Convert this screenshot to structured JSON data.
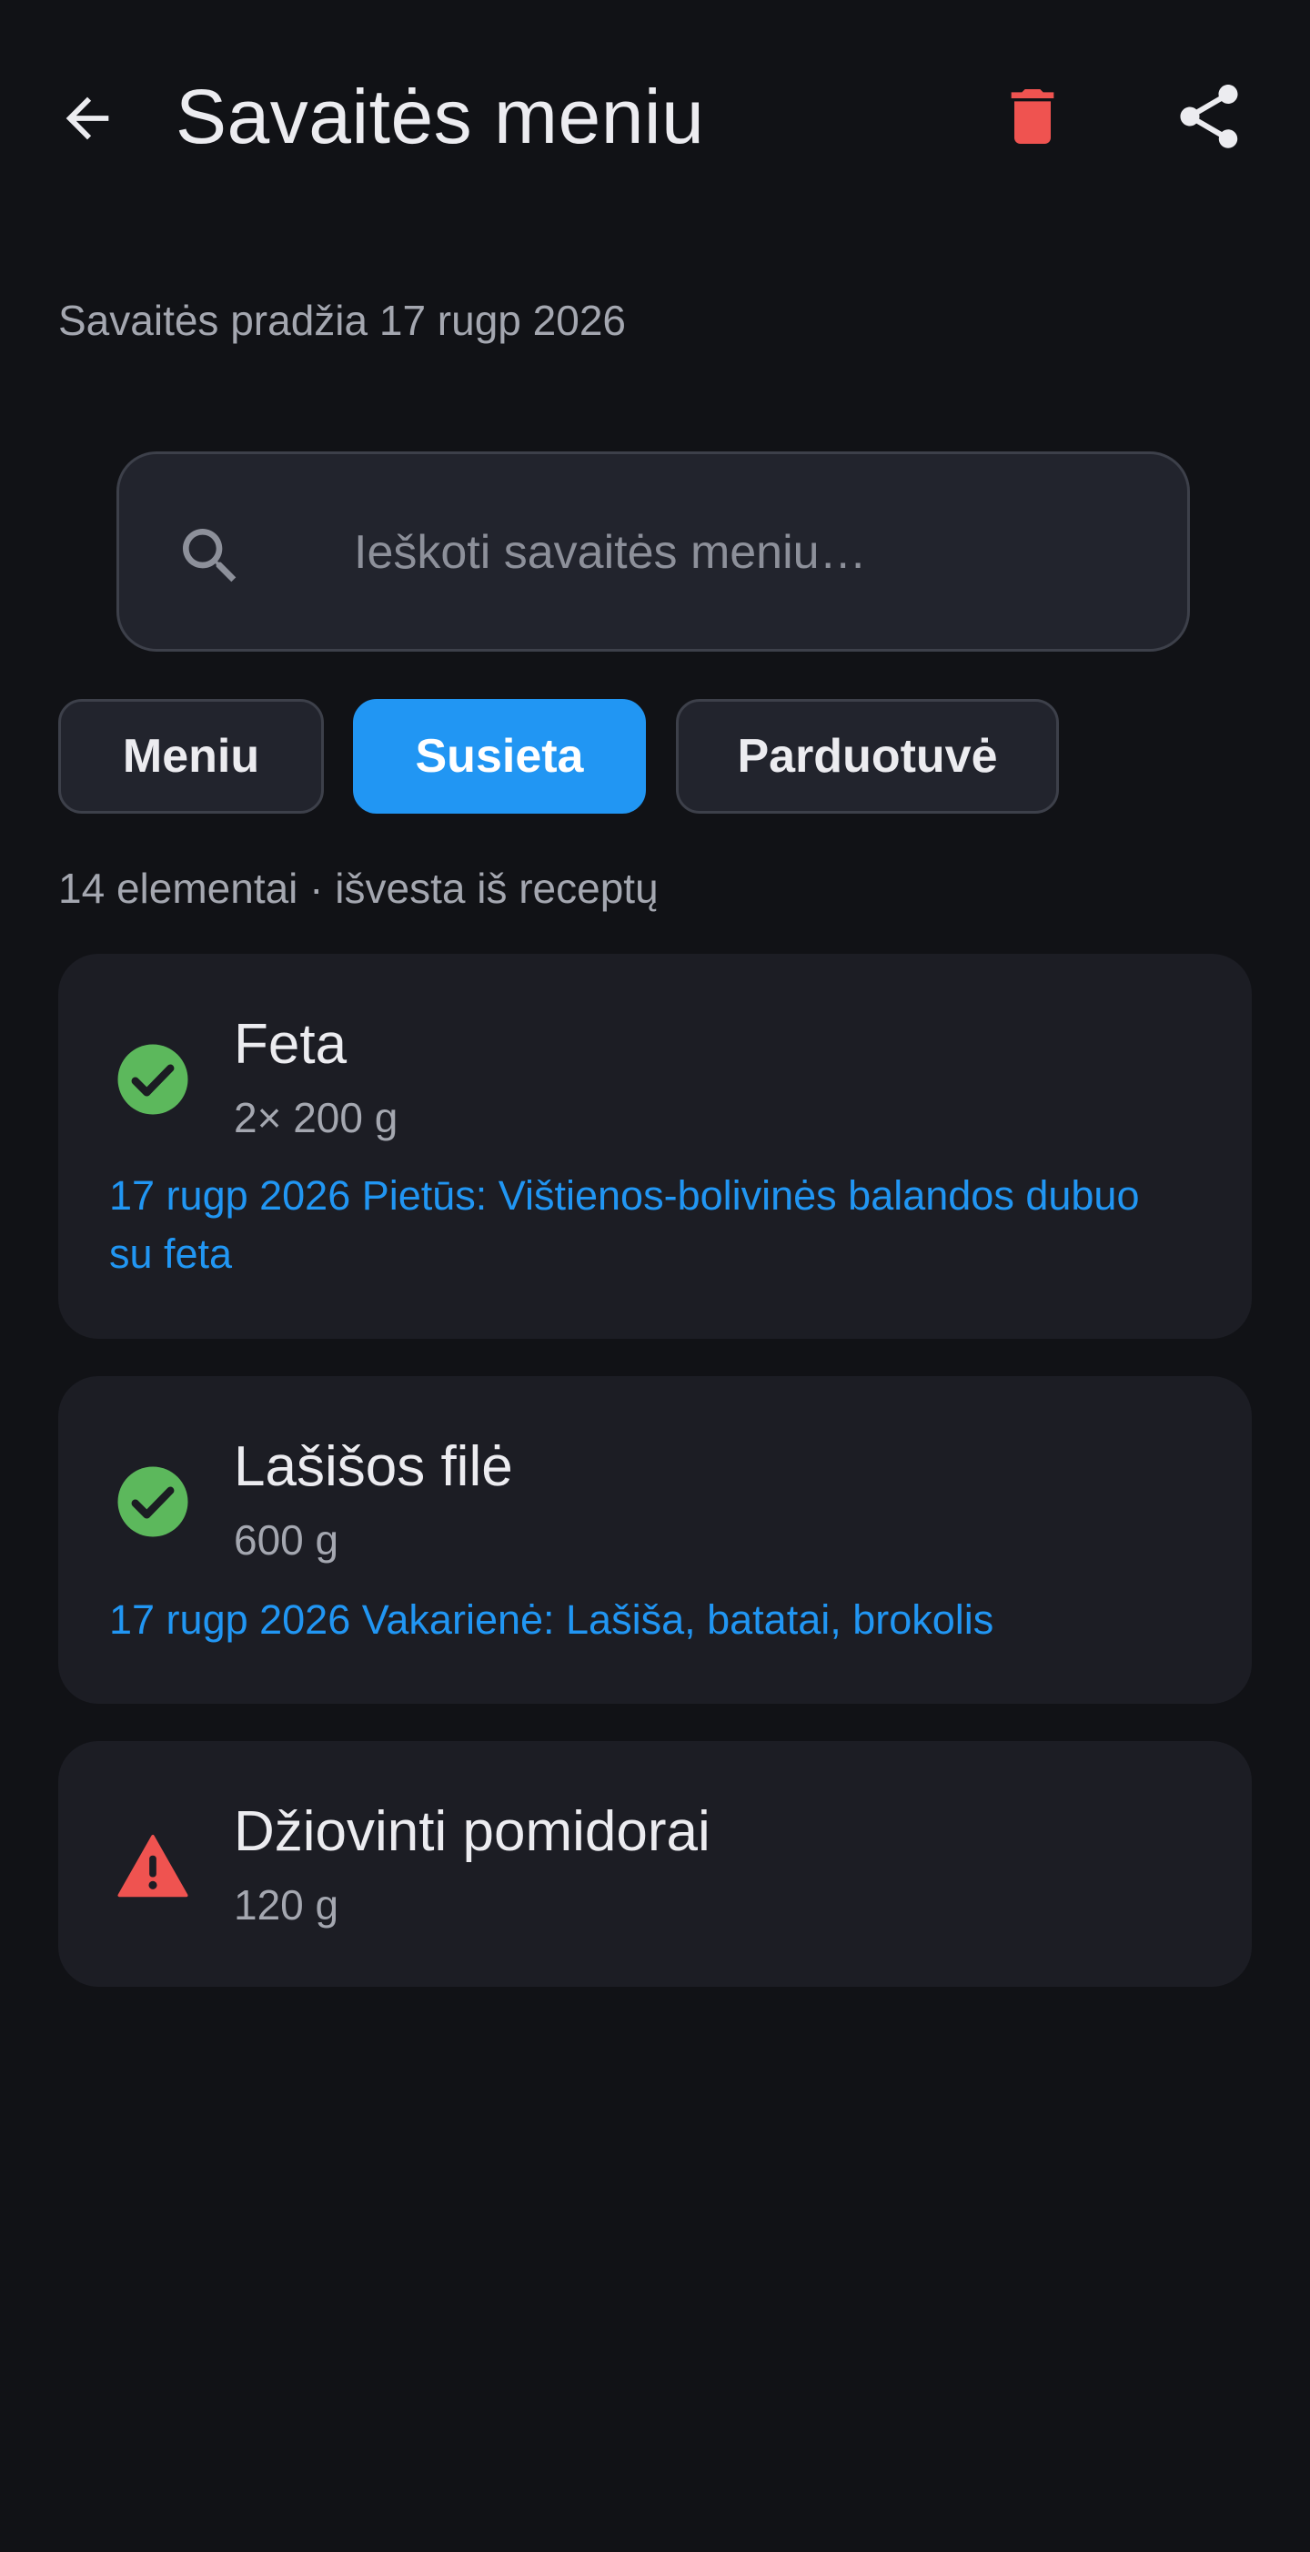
{
  "header": {
    "title": "Savaitės meniu",
    "back_icon": "arrow-left-icon",
    "delete_icon": "trash-icon",
    "share_icon": "share-icon"
  },
  "week_start": "Savaitės pradžia 17 rugp 2026",
  "search": {
    "placeholder": "Ieškoti savaitės meniu…",
    "value": ""
  },
  "tabs": [
    {
      "label": "Meniu",
      "active": false
    },
    {
      "label": "Susieta",
      "active": true
    },
    {
      "label": "Parduotuvė",
      "active": false
    }
  ],
  "summary": "14 elementai · išvesta iš receptų",
  "items": [
    {
      "name": "Feta",
      "quantity": "2× 200 g",
      "status": "check-circle-icon",
      "link": "17 rugp 2026 Pietūs: Vištienos-bolivinės balandos dubuo su feta"
    },
    {
      "name": "Lašišos filė",
      "quantity": "600 g",
      "status": "check-circle-icon",
      "link": "17 rugp 2026 Vakarienė: Lašiša, batatai, brokolis"
    },
    {
      "name": "Džiovinti pomidorai",
      "quantity": "120 g",
      "status": "warning-icon",
      "link": ""
    }
  ],
  "colors": {
    "background": "#111216",
    "card": "#1c1d24",
    "accent": "#2196f3",
    "success": "#5cb85c",
    "danger": "#ef5350"
  }
}
